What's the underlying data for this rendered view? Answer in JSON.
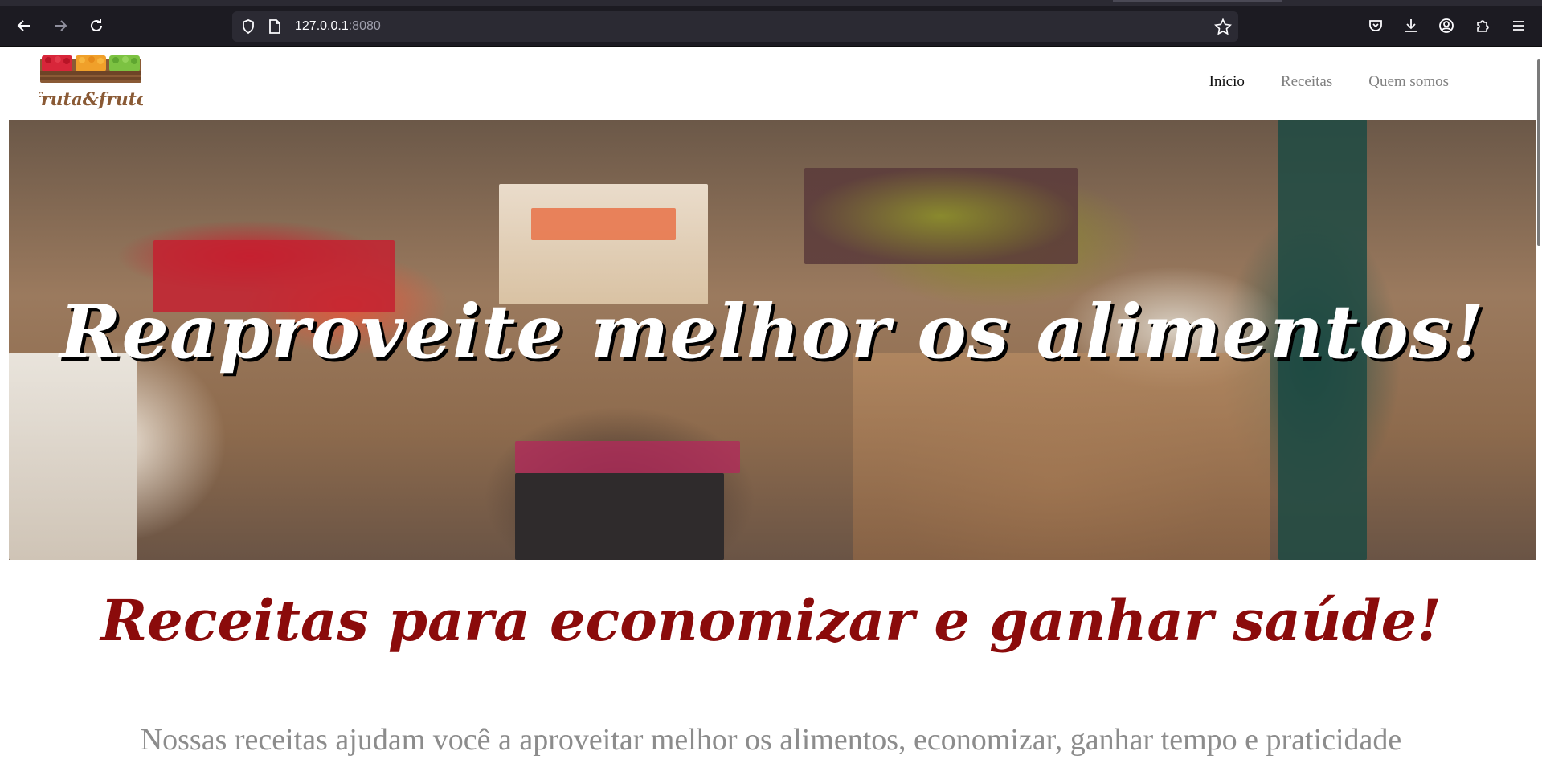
{
  "browser": {
    "url_host": "127.0.0.1",
    "url_port": ":8080"
  },
  "site": {
    "logo_text": "fruta&fruto",
    "nav": [
      {
        "label": "Início",
        "active": true
      },
      {
        "label": "Receitas",
        "active": false
      },
      {
        "label": "Quem somos",
        "active": false
      }
    ]
  },
  "hero": {
    "title": "Reaproveite melhor os alimentos!"
  },
  "main": {
    "section_title": "Receitas para economizar e ganhar saúde!",
    "section_text": "Nossas receitas ajudam você a aproveitar melhor os alimentos, economizar, ganhar tempo e praticidade"
  },
  "colors": {
    "chrome_bg": "#1c1b22",
    "urlbar_bg": "#2b2a33",
    "title_red": "#8b0b0b",
    "nav_active": "#111111",
    "nav_inactive": "#808080"
  },
  "icons": [
    "back-icon",
    "forward-icon",
    "reload-icon",
    "shield-icon",
    "page-icon",
    "bookmark-star-icon",
    "pocket-icon",
    "download-icon",
    "account-icon",
    "extensions-icon",
    "menu-icon"
  ]
}
